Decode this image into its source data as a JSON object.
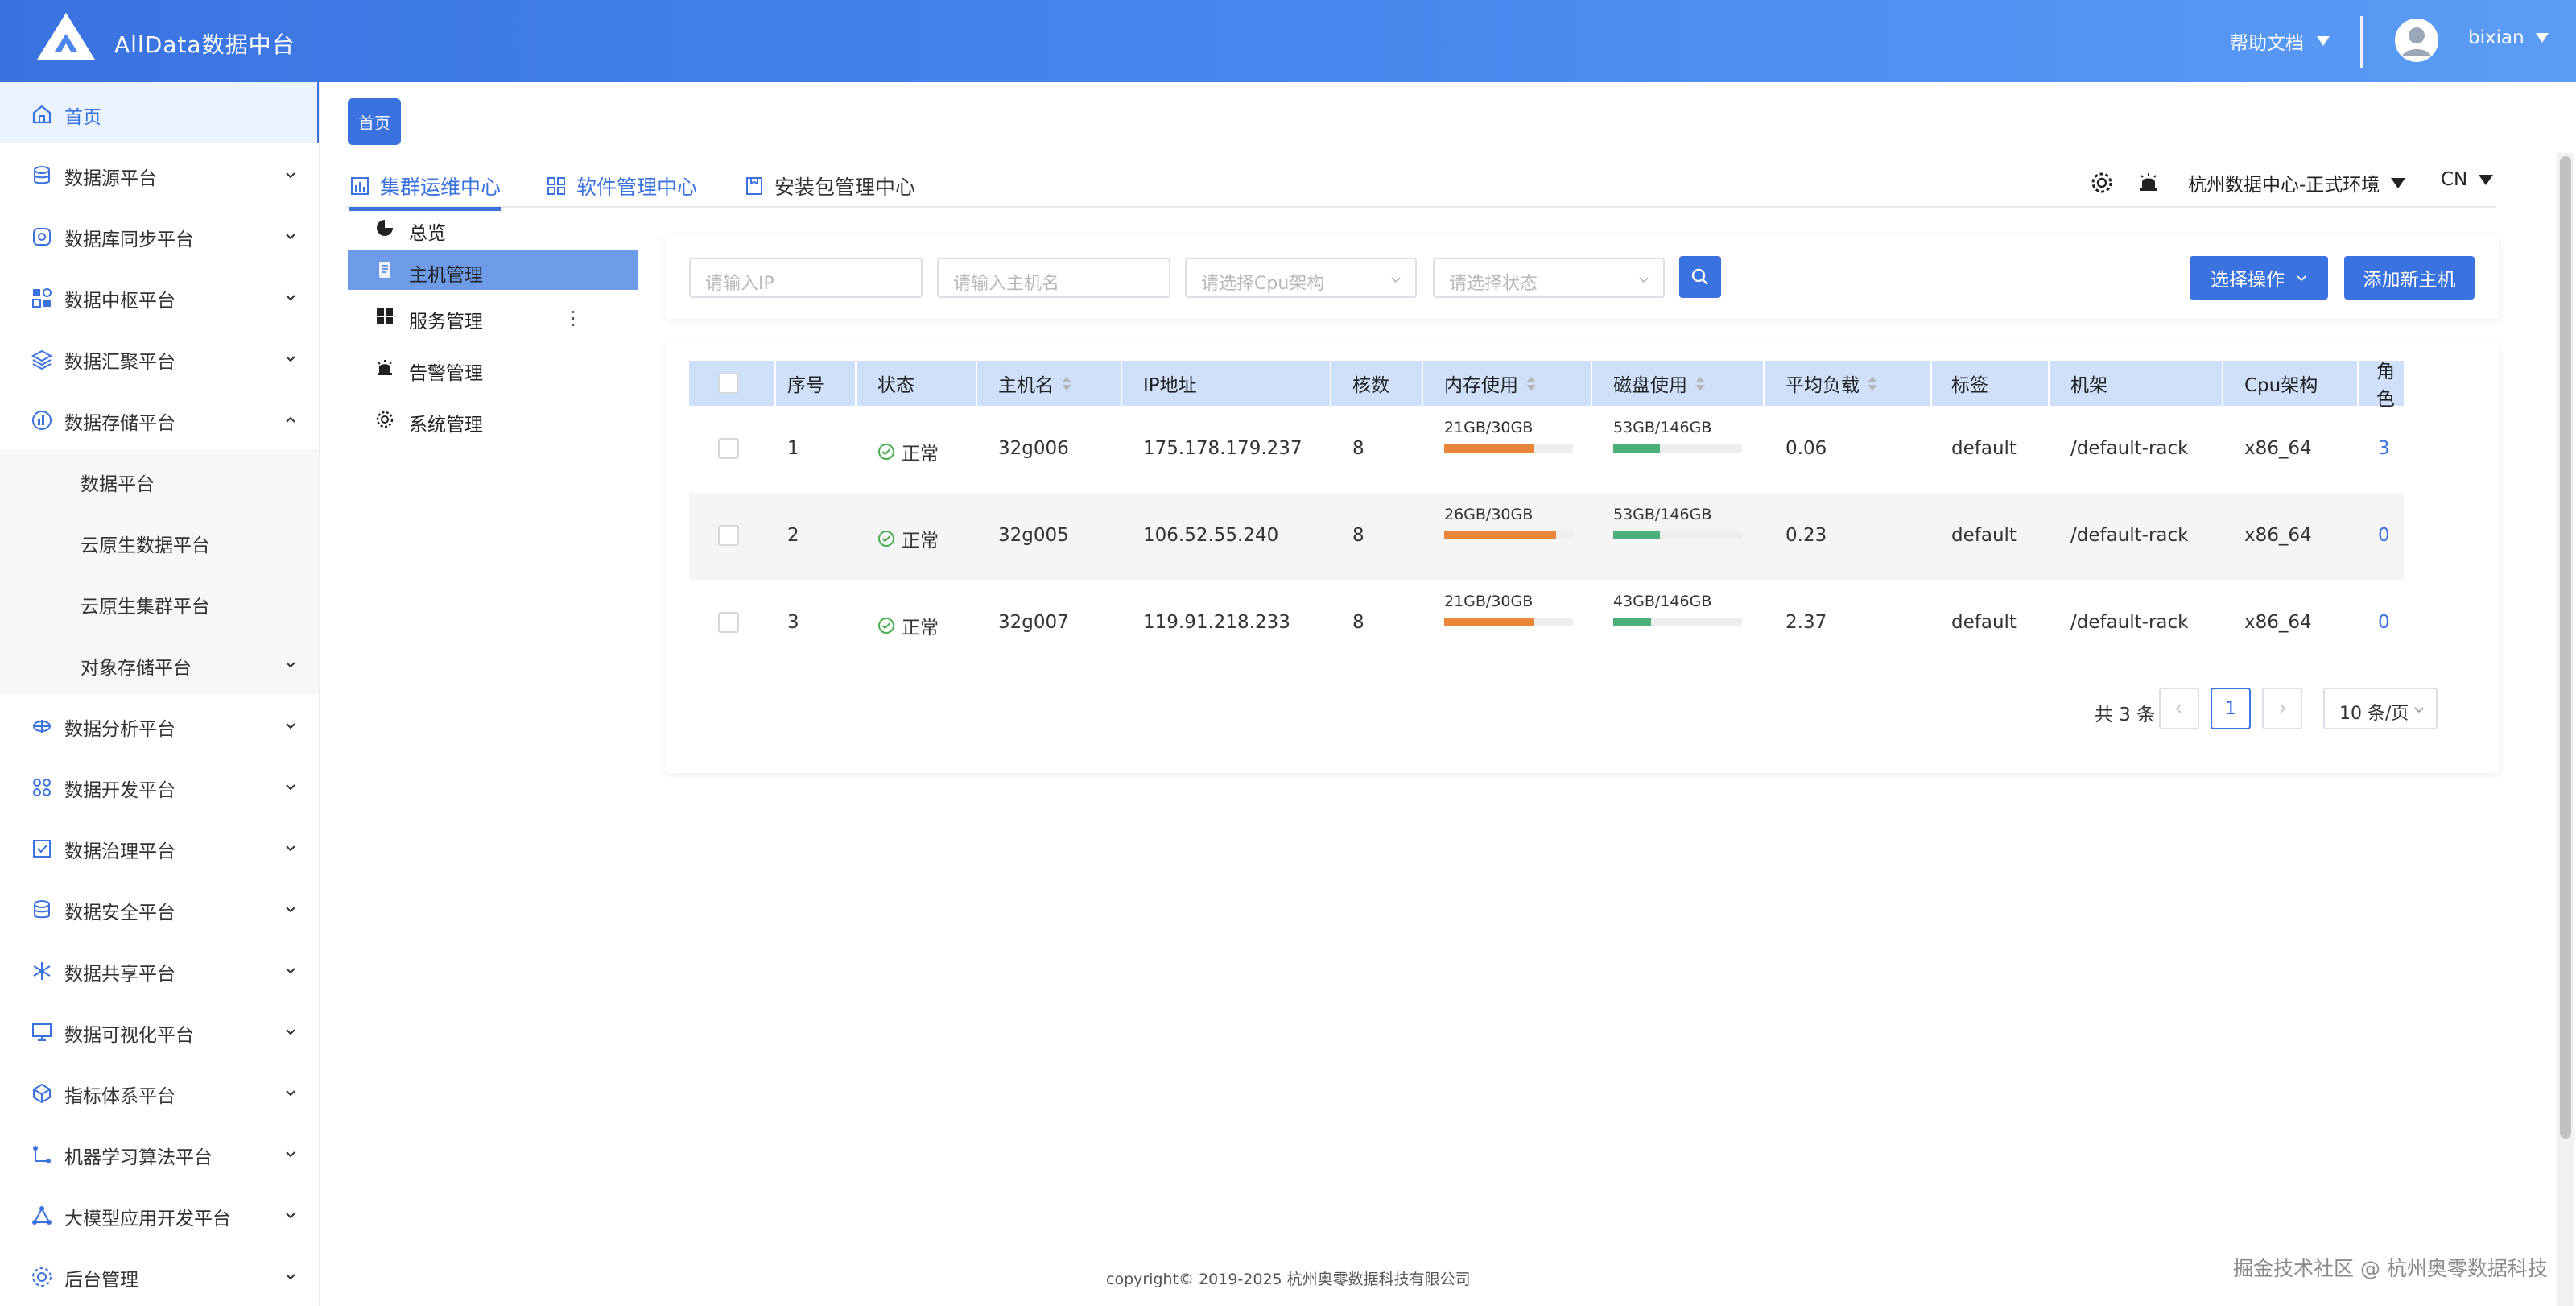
{
  "app": {
    "title": "AllData数据中台"
  },
  "header": {
    "help_label": "帮助文档",
    "username": "bixian"
  },
  "sidebar": {
    "items": [
      {
        "label": "首页",
        "icon": "home-icon",
        "active": true
      },
      {
        "label": "数据源平台",
        "icon": "database-icon"
      },
      {
        "label": "数据库同步平台",
        "icon": "sync-icon"
      },
      {
        "label": "数据中枢平台",
        "icon": "grid-icon"
      },
      {
        "label": "数据汇聚平台",
        "icon": "layers-icon"
      },
      {
        "label": "数据存储平台",
        "icon": "storage-icon",
        "expanded": true
      },
      {
        "label": "数据分析平台",
        "icon": "analysis-icon"
      },
      {
        "label": "数据开发平台",
        "icon": "dev-icon"
      },
      {
        "label": "数据治理平台",
        "icon": "governance-icon"
      },
      {
        "label": "数据安全平台",
        "icon": "security-icon"
      },
      {
        "label": "数据共享平台",
        "icon": "share-icon"
      },
      {
        "label": "数据可视化平台",
        "icon": "monitor-icon"
      },
      {
        "label": "指标体系平台",
        "icon": "cube-icon"
      },
      {
        "label": "机器学习算法平台",
        "icon": "ml-icon"
      },
      {
        "label": "大模型应用开发平台",
        "icon": "model-icon"
      },
      {
        "label": "后台管理",
        "icon": "admin-icon"
      }
    ],
    "sub_items": [
      {
        "label": "数据平台"
      },
      {
        "label": "云原生数据平台"
      },
      {
        "label": "云原生集群平台"
      },
      {
        "label": "对象存储平台"
      }
    ]
  },
  "page_tag": "首页",
  "tabs": [
    {
      "label": "集群运维中心",
      "icon": "chart-icon",
      "active": true
    },
    {
      "label": "软件管理中心",
      "icon": "apps-icon"
    },
    {
      "label": "安装包管理中心",
      "icon": "package-icon"
    }
  ],
  "toolbar": {
    "environment": "杭州数据中心-正式环境",
    "language": "CN"
  },
  "submenu": [
    {
      "label": "总览",
      "icon": "pie-icon"
    },
    {
      "label": "主机管理",
      "icon": "host-icon",
      "active": true
    },
    {
      "label": "服务管理",
      "icon": "services-icon"
    },
    {
      "label": "告警管理",
      "icon": "alarm-icon"
    },
    {
      "label": "系统管理",
      "icon": "settings-icon"
    }
  ],
  "filters": {
    "ip_placeholder": "请输入IP",
    "hostname_placeholder": "请输入主机名",
    "cpu_placeholder": "请选择Cpu架构",
    "status_placeholder": "请选择状态",
    "action_label": "选择操作",
    "add_label": "添加新主机"
  },
  "table": {
    "columns": [
      "序号",
      "状态",
      "主机名",
      "IP地址",
      "核数",
      "内存使用",
      "磁盘使用",
      "平均负载",
      "标签",
      "机架",
      "Cpu架构",
      "角色"
    ],
    "rows": [
      {
        "index": "1",
        "status": "正常",
        "hostname": "32g006",
        "ip": "175.178.179.237",
        "cores": "8",
        "mem_text": "21GB/30GB",
        "mem_ratio": 0.7,
        "disk_text": "53GB/146GB",
        "disk_ratio": 0.363,
        "load": "0.06",
        "tag": "default",
        "rack": "/default-rack",
        "cpu": "x86_64",
        "role": "3"
      },
      {
        "index": "2",
        "status": "正常",
        "hostname": "32g005",
        "ip": "106.52.55.240",
        "cores": "8",
        "mem_text": "26GB/30GB",
        "mem_ratio": 0.867,
        "disk_text": "53GB/146GB",
        "disk_ratio": 0.363,
        "load": "0.23",
        "tag": "default",
        "rack": "/default-rack",
        "cpu": "x86_64",
        "role": "0"
      },
      {
        "index": "3",
        "status": "正常",
        "hostname": "32g007",
        "ip": "119.91.218.233",
        "cores": "8",
        "mem_text": "21GB/30GB",
        "mem_ratio": 0.7,
        "disk_text": "43GB/146GB",
        "disk_ratio": 0.295,
        "load": "2.37",
        "tag": "default",
        "rack": "/default-rack",
        "cpu": "x86_64",
        "role": "0"
      }
    ]
  },
  "pagination": {
    "total_label": "共 3 条",
    "current_page": "1",
    "page_size": "10 条/页"
  },
  "footer": "copyright© 2019-2025 杭州奥零数据科技有限公司",
  "watermark": "掘金技术社区 @ 杭州奥零数据科技",
  "colors": {
    "primary": "#3a73e0",
    "mem_bar": "#e8873a",
    "disk_bar": "#4caf7a",
    "header_bg": "#4a8bf0"
  }
}
